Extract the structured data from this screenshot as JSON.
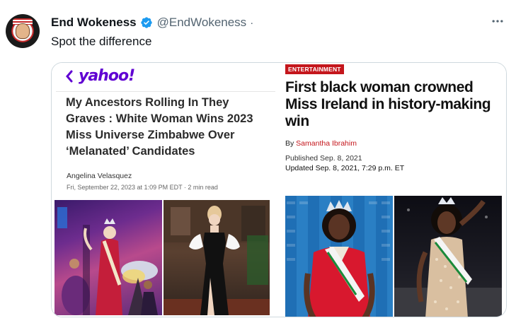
{
  "tweet": {
    "display_name": "End Wokeness",
    "handle": "@EndWokeness",
    "separator": "·",
    "text": "Spot the difference",
    "more_icon": "more-horizontal-icon",
    "verified_icon": "verified-badge-icon",
    "accent_color": "#1d9bf0"
  },
  "left_article": {
    "source": "yahoo!",
    "back_icon": "chevron-left-icon",
    "headline": "My Ancestors Rolling In They Graves : White Woman Wins 2023 Miss Universe Zimbabwe Over ‘Melanated’ Candidates",
    "author": "Angelina Velasquez",
    "date_line": "Fri, September 22, 2023 at 1:09 PM EDT  ·  2 min read",
    "brand_color": "#6001d2"
  },
  "right_article": {
    "section_tag": "ENTERTAINMENT",
    "headline": "First black woman crowned Miss Ireland in history-making win",
    "byline_prefix": "By ",
    "author": "Samantha Ibrahim",
    "published": "Published Sep. 8, 2021",
    "updated": "Updated Sep. 8, 2021, 7:29 p.m. ET",
    "tag_color": "#c4161c"
  }
}
